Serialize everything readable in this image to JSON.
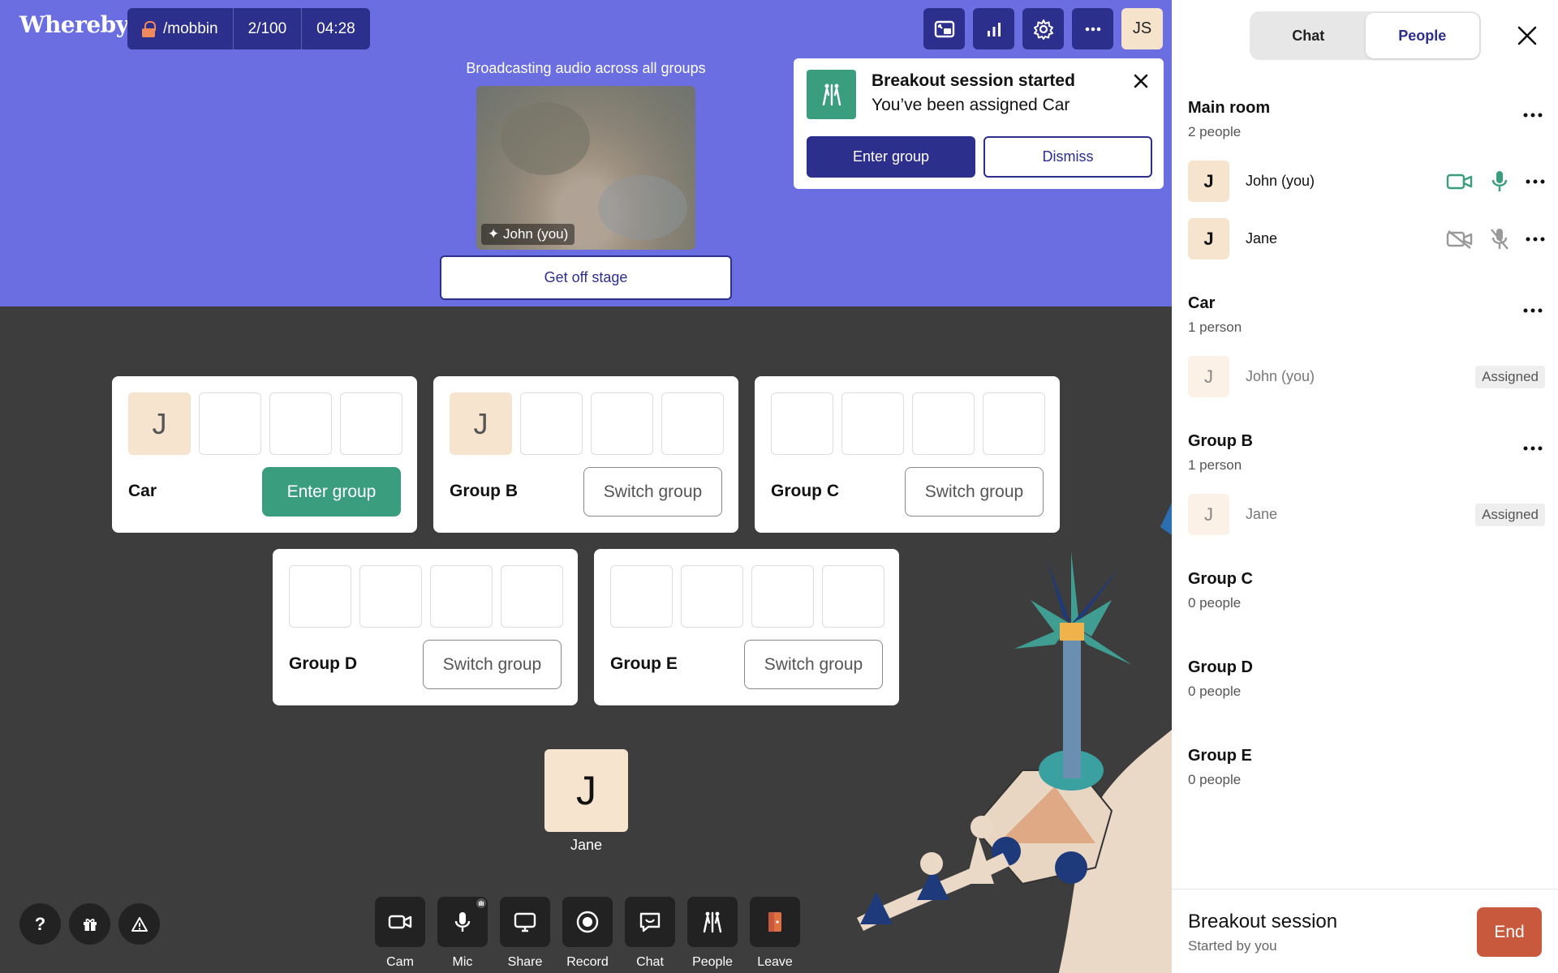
{
  "app": {
    "logo": "Whereby"
  },
  "room": {
    "name": "/mobbin",
    "participants": "2/100",
    "timer": "04:28"
  },
  "top_actions": {
    "user_initials": "JS"
  },
  "stage": {
    "broadcast_text": "Broadcasting audio across all groups",
    "video_label": "John (you)",
    "get_off_label": "Get off stage"
  },
  "toast": {
    "title": "Breakout session started",
    "subtitle": "You’ve been assigned Car",
    "enter_label": "Enter group",
    "dismiss_label": "Dismiss"
  },
  "groups": [
    {
      "name": "Car",
      "slots": [
        "J",
        "",
        "",
        ""
      ],
      "button": "Enter group"
    },
    {
      "name": "Group B",
      "slots": [
        "J",
        "",
        "",
        ""
      ],
      "button": "Switch group"
    },
    {
      "name": "Group C",
      "slots": [
        "",
        "",
        "",
        ""
      ],
      "button": "Switch group"
    },
    {
      "name": "Group D",
      "slots": [
        "",
        "",
        "",
        ""
      ],
      "button": "Switch group"
    },
    {
      "name": "Group E",
      "slots": [
        "",
        "",
        "",
        ""
      ],
      "button": "Switch group"
    }
  ],
  "unassigned": {
    "initial": "J",
    "name": "Jane"
  },
  "help_buttons": [
    {
      "glyph": "?"
    }
  ],
  "toolbar": [
    {
      "label": "Cam",
      "icon": "camera-icon"
    },
    {
      "label": "Mic",
      "icon": "mic-icon"
    },
    {
      "label": "Share",
      "icon": "screen-share-icon"
    },
    {
      "label": "Record",
      "icon": "record-icon"
    },
    {
      "label": "Chat",
      "icon": "chat-icon"
    },
    {
      "label": "People",
      "icon": "people-icon"
    },
    {
      "label": "Leave",
      "icon": "leave-icon"
    }
  ],
  "panel": {
    "tabs": [
      "Chat",
      "People"
    ],
    "active_tab": "People",
    "sections": [
      {
        "title": "Main room",
        "count": "2 people",
        "people": [
          {
            "initial": "J",
            "name": "John (you)",
            "cam": "on",
            "mic": "on"
          },
          {
            "initial": "J",
            "name": "Jane",
            "cam": "off",
            "mic": "off"
          }
        ]
      },
      {
        "title": "Car",
        "count": "1 person",
        "people": [
          {
            "initial": "J",
            "name": "John (you)",
            "badge": "Assigned"
          }
        ]
      },
      {
        "title": "Group B",
        "count": "1 person",
        "people": [
          {
            "initial": "J",
            "name": "Jane",
            "badge": "Assigned"
          }
        ]
      },
      {
        "title": "Group C",
        "count": "0 people"
      },
      {
        "title": "Group D",
        "count": "0 people"
      },
      {
        "title": "Group E",
        "count": "0 people"
      }
    ],
    "footer": {
      "title": "Breakout session",
      "subtitle": "Started by you",
      "end_label": "End"
    }
  },
  "colors": {
    "stage": "#6b6ee0",
    "navy": "#2c2f8c",
    "green": "#3a9d7e",
    "end": "#c8593d",
    "avatar": "#f6e4cf",
    "background": "#3d3d3d"
  }
}
